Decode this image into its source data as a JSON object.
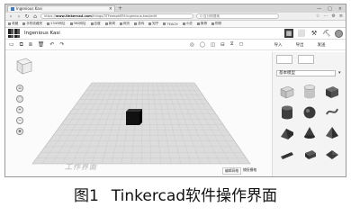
{
  "browser": {
    "tab_title": "Ingenious Kasi",
    "tab_plus": "+",
    "close": "×",
    "window_controls": [
      "—",
      "□",
      "×"
    ],
    "nav": [
      "‹",
      "›",
      "↻",
      "⌂"
    ],
    "url_prefix": "https://",
    "url_domain": "www.tinkercad.com",
    "url_rest": "/things/3TFewsokERf-ingenious-kasi/edit",
    "search_placeholder": "Q 百分网搜索",
    "toolbar_icons": [
      "☆",
      "⋯",
      "⚙",
      "≡"
    ],
    "bookmarks": [
      "收藏",
      "手机收藏夹",
      "2345网址",
      "360网址",
      "百度",
      "新闻",
      "网页",
      "游戏",
      "知乎",
      "TEACH",
      "小说",
      "微博",
      "购物"
    ]
  },
  "tinkercad": {
    "project_name": "Ingenious Kasi",
    "view_buttons": [
      "▦",
      "⬜",
      "⚒",
      "⛏"
    ],
    "toolbar_left": [
      "▭",
      "⧉",
      "⧈",
      "🗑",
      "↶",
      "↷"
    ],
    "toolbar_mid": [
      "◎",
      "◯",
      "◫",
      "⊟",
      "⧖",
      "⎔"
    ],
    "panel_tabs": [
      "导入",
      "导出",
      "发送"
    ],
    "shape_library": "基本模型",
    "edit_grid": "编辑网格",
    "snap_grid": "捕捉栅格",
    "watermark": "工作界面"
  },
  "caption": {
    "figure_num": "图1",
    "text": "Tinkercad软件操作界面"
  },
  "colors": {
    "cube": "#111111",
    "workplane": "#dcdcdc",
    "grid_line": "#c4c4c4"
  }
}
